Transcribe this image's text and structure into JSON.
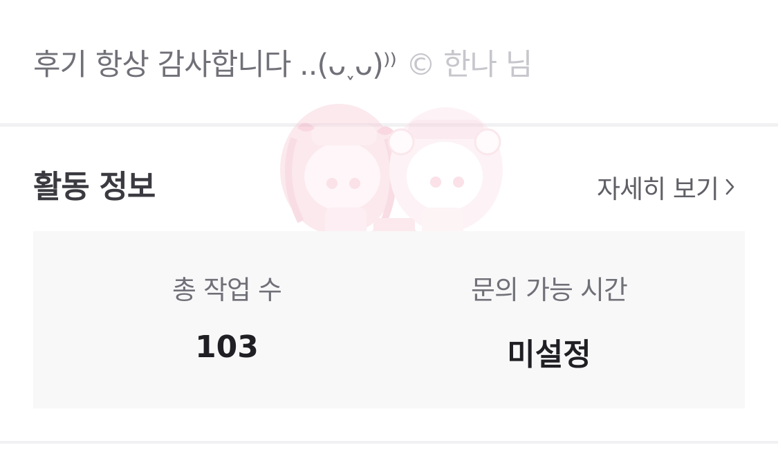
{
  "review": {
    "text": "후기 항상 감사합니다 ..(ᴗ˯ᴗ)⁾⁾",
    "copyright_symbol": "©",
    "author": "한나 님"
  },
  "activity": {
    "title": "활동 정보",
    "more_label": "자세히 보기",
    "stats": [
      {
        "label": "총 작업 수",
        "value": "103"
      },
      {
        "label": "문의 가능 시간",
        "value": "미설정"
      }
    ]
  },
  "icons": {
    "more": "chevron-right-icon",
    "watermark": "illustration-watermark"
  },
  "colors": {
    "background": "#ffffff",
    "stats_box": "#f8f8f9",
    "divider": "#f1f1f3",
    "watermark_pink": "#f4b8c8"
  }
}
